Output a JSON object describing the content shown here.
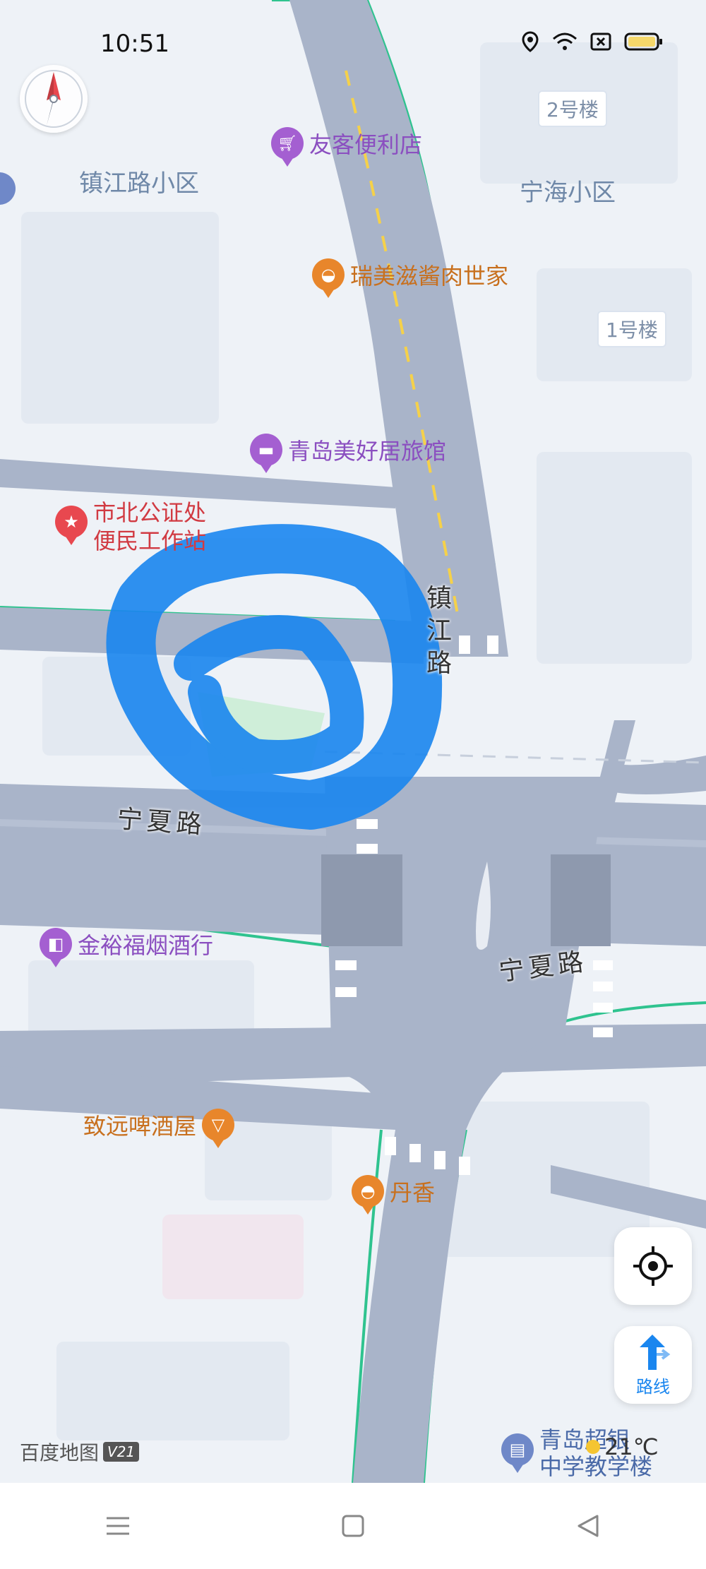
{
  "status": {
    "time": "10:51",
    "battery_color": "#f5d86b"
  },
  "map": {
    "areas": [
      "镇江路小区",
      "宁海小区"
    ],
    "building_tags": [
      "2号楼",
      "1号楼"
    ],
    "roads": {
      "zhenjiang": [
        "镇",
        "江",
        "路"
      ],
      "ningxia_west": "宁夏路",
      "ningxia_east": "宁夏路"
    },
    "pois": [
      {
        "name": "友客便利店",
        "color": "#a45fd1",
        "icon": "cart-icon"
      },
      {
        "name": "瑞美滋酱肉世家",
        "color": "#e8862b",
        "icon": "food-icon"
      },
      {
        "name": "青岛美好居旅馆",
        "color": "#a45fd1",
        "icon": "bed-icon"
      },
      {
        "name": "市北公证处",
        "name2": "便民工作站",
        "color": "#e8484f",
        "icon": "star-icon"
      },
      {
        "name": "金裕福烟酒行",
        "color": "#a45fd1",
        "icon": "bag-icon"
      },
      {
        "name": "致远啤酒屋",
        "color": "#e8862b",
        "icon": "cocktail-icon"
      },
      {
        "name": "丹香",
        "color": "#e8862b",
        "icon": "bread-icon"
      },
      {
        "name": "青岛超银",
        "name2": "中学教学楼",
        "color": "#6f88c8",
        "icon": "school-icon"
      }
    ],
    "road_color": "#a9b4c9",
    "edge_color": "#2fc38f",
    "highlight_color": "#1a86ef"
  },
  "controls": {
    "route_label": "路线"
  },
  "watermark": {
    "brand": "百度地图",
    "version": "V21"
  },
  "weather": {
    "temp": "21℃"
  }
}
